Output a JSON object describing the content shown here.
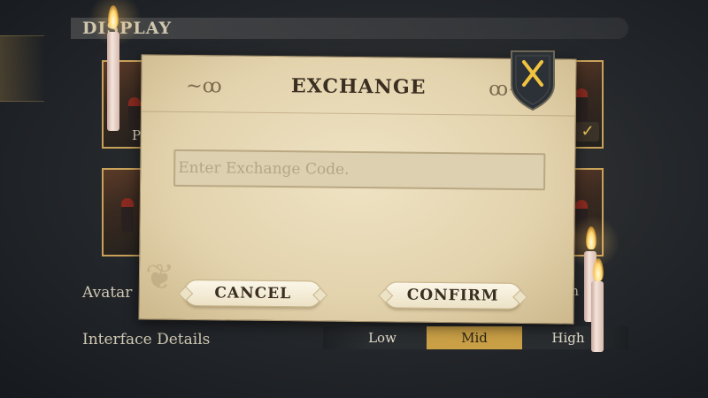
{
  "background": {
    "section_title": "DISPLAY",
    "thumb_label_partial": "Po",
    "avatar_label_partial": "Avatar",
    "avatar_high_partial": "igh",
    "interface_details": {
      "label": "Interface Details",
      "options": [
        "Low",
        "Mid",
        "High"
      ],
      "selected": "Mid"
    }
  },
  "dialog": {
    "title": "EXCHANGE",
    "input_placeholder": "Enter Exchange Code.",
    "input_value": "",
    "cancel_label": "CANCEL",
    "confirm_label": "CONFIRM",
    "close_icon": "close-x-icon"
  },
  "colors": {
    "accent_gold": "#caa046",
    "parchment": "#e8dab8",
    "shield": "#2b3136"
  }
}
